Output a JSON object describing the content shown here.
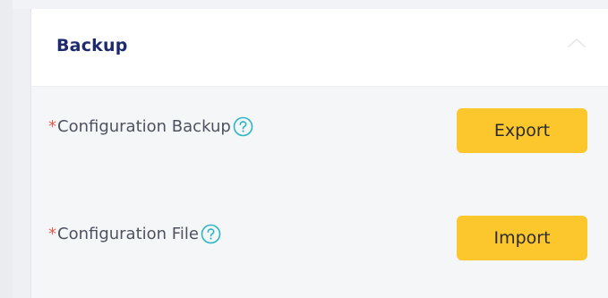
{
  "section": {
    "title": "Backup",
    "collapse_icon": "chevron-up-icon"
  },
  "rows": [
    {
      "required_mark": "*",
      "label": "Configuration Backup",
      "help_icon": "question-circle-icon",
      "button_label": "Export"
    },
    {
      "required_mark": "*",
      "label": "Configuration File",
      "help_icon": "question-circle-icon",
      "button_label": "Import"
    }
  ],
  "colors": {
    "title": "#1e2a6e",
    "required": "#e35d4e",
    "help_icon": "#2bb5c8",
    "button": "#fcc72c",
    "label": "#4d5260"
  }
}
